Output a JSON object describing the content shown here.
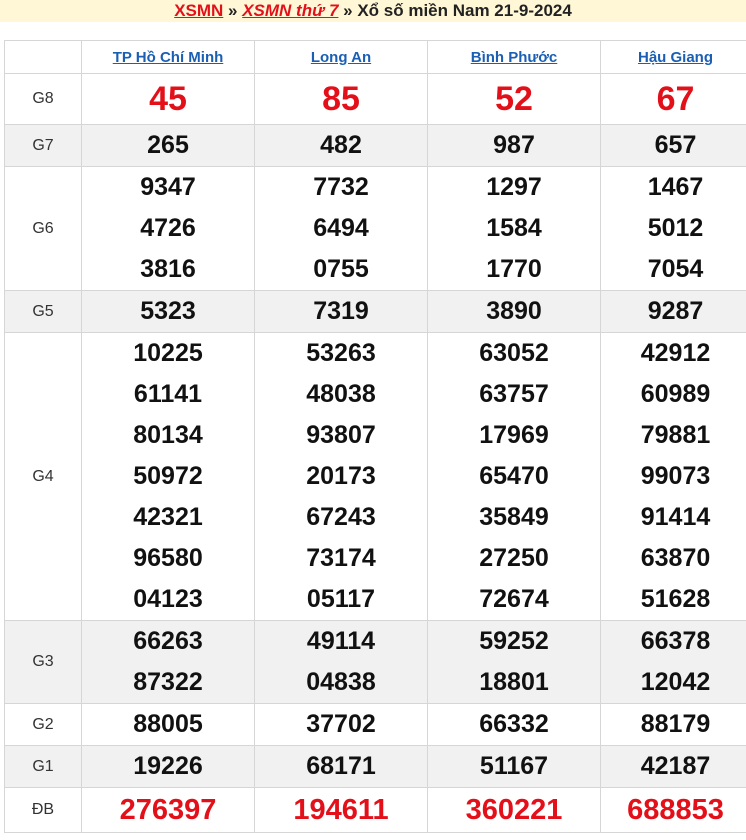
{
  "breadcrumb": {
    "link1": "XSMN",
    "sep1": " » ",
    "link2": "XSMN thứ 7",
    "sep2": " » ",
    "title": "Xổ số miền Nam 21-9-2024"
  },
  "colors": {
    "accent_red": "#e3101a",
    "link_blue": "#1a5fb4",
    "header_bg": "#fff7d6"
  },
  "provinces": [
    "TP Hồ Chí Minh",
    "Long An",
    "Bình Phước",
    "Hậu Giang"
  ],
  "prizes": [
    {
      "label": "G8",
      "values": [
        [
          "45"
        ],
        [
          "85"
        ],
        [
          "52"
        ],
        [
          "67"
        ]
      ]
    },
    {
      "label": "G7",
      "values": [
        [
          "265"
        ],
        [
          "482"
        ],
        [
          "987"
        ],
        [
          "657"
        ]
      ]
    },
    {
      "label": "G6",
      "values": [
        [
          "9347",
          "4726",
          "3816"
        ],
        [
          "7732",
          "6494",
          "0755"
        ],
        [
          "1297",
          "1584",
          "1770"
        ],
        [
          "1467",
          "5012",
          "7054"
        ]
      ]
    },
    {
      "label": "G5",
      "values": [
        [
          "5323"
        ],
        [
          "7319"
        ],
        [
          "3890"
        ],
        [
          "9287"
        ]
      ]
    },
    {
      "label": "G4",
      "values": [
        [
          "10225",
          "61141",
          "80134",
          "50972",
          "42321",
          "96580",
          "04123"
        ],
        [
          "53263",
          "48038",
          "93807",
          "20173",
          "67243",
          "73174",
          "05117"
        ],
        [
          "63052",
          "63757",
          "17969",
          "65470",
          "35849",
          "27250",
          "72674"
        ],
        [
          "42912",
          "60989",
          "79881",
          "99073",
          "91414",
          "63870",
          "51628"
        ]
      ]
    },
    {
      "label": "G3",
      "values": [
        [
          "66263",
          "87322"
        ],
        [
          "49114",
          "04838"
        ],
        [
          "59252",
          "18801"
        ],
        [
          "66378",
          "12042"
        ]
      ]
    },
    {
      "label": "G2",
      "values": [
        [
          "88005"
        ],
        [
          "37702"
        ],
        [
          "66332"
        ],
        [
          "88179"
        ]
      ]
    },
    {
      "label": "G1",
      "values": [
        [
          "19226"
        ],
        [
          "68171"
        ],
        [
          "51167"
        ],
        [
          "42187"
        ]
      ]
    },
    {
      "label": "ĐB",
      "values": [
        [
          "276397"
        ],
        [
          "194611"
        ],
        [
          "360221"
        ],
        [
          "688853"
        ]
      ]
    }
  ]
}
